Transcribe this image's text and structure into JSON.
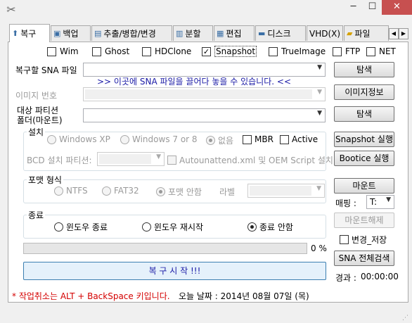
{
  "window": {
    "close_glyph": "✕",
    "min_glyph": "─",
    "max_glyph": "☐"
  },
  "tabs": [
    {
      "label": "복구",
      "icon": "restore-icon"
    },
    {
      "label": "백업",
      "icon": "disk-icon"
    },
    {
      "label": "추출/병합/변경",
      "icon": "chip-icon"
    },
    {
      "label": "분할",
      "icon": "split-icon"
    },
    {
      "label": "편집",
      "icon": "edit-icon"
    },
    {
      "label": "디스크",
      "icon": "drive-icon"
    },
    {
      "label": "VHD(X)",
      "icon": ""
    },
    {
      "label": "파일",
      "icon": "folder-icon"
    }
  ],
  "formats": [
    {
      "label": "Wim",
      "checked": false
    },
    {
      "label": "Ghost",
      "checked": false
    },
    {
      "label": "HDClone",
      "checked": false
    },
    {
      "label": "Snapshot",
      "checked": true
    },
    {
      "label": "TrueImage",
      "checked": false
    },
    {
      "label": "FTP",
      "checked": false
    },
    {
      "label": "NET",
      "checked": false
    }
  ],
  "restore_file": {
    "label": "복구할 SNA 파일",
    "hint": ">> 이곳에 SNA 파일을 끌어다 놓을 수 있습니다. <<",
    "browse": "탐색"
  },
  "image_number": {
    "label": "이미지 번호",
    "info": "이미지정보"
  },
  "target": {
    "label_line1": "대상 파티션",
    "label_line2": "폴더(마운트)",
    "browse": "탐색"
  },
  "install": {
    "title": "설치",
    "options": [
      {
        "label": "Windows XP",
        "checked": false,
        "enabled": false
      },
      {
        "label": "Windows 7 or 8",
        "checked": false,
        "enabled": false
      },
      {
        "label": "없음",
        "checked": true,
        "enabled": false
      }
    ],
    "mbr": "MBR",
    "active": "Active",
    "bcd_label": "BCD 설치 파티션:",
    "autounattend": "Autounattend.xml 및 OEM Script 설치",
    "snapshot_run": "Snapshot 실행",
    "bootice_run": "Bootice 실행"
  },
  "format": {
    "title": "포맷 형식",
    "options": [
      {
        "label": "NTFS",
        "checked": false
      },
      {
        "label": "FAT32",
        "checked": false
      },
      {
        "label": "포맷 안함",
        "checked": true
      }
    ],
    "label_text": "라벨"
  },
  "mount": {
    "button": "마운트",
    "mapping_label": "매핑 :",
    "drive": "T:",
    "unmount": "마운트해제"
  },
  "shutdown": {
    "title": "종료",
    "options": [
      {
        "label": "윈도우 종료",
        "checked": false
      },
      {
        "label": "윈도우 재시작",
        "checked": false
      },
      {
        "label": "종료 안함",
        "checked": true
      }
    ],
    "change_save": "변경_저장"
  },
  "progress": {
    "percent_text": "0 %",
    "value": 0
  },
  "start_button": "복 구 시 작 !!!",
  "search_all": "SNA 전체검색",
  "elapsed": {
    "label": "경과 :",
    "time": "00:00:00"
  },
  "status": {
    "cancel_hint": "* 작업취소는 ALT + BackSpace 키입니다.",
    "date": "오늘 날짜 : 2014년 08월 07일 (목)"
  }
}
